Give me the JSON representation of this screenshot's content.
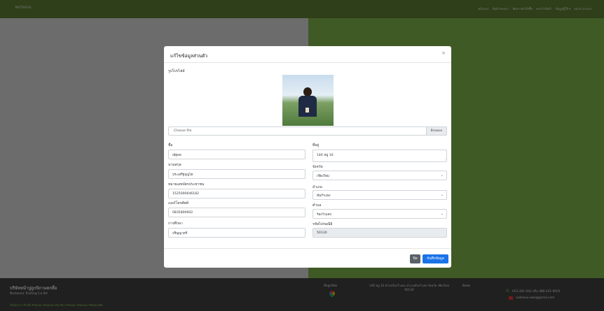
{
  "navbar": {
    "brand": "NUTSEEUI",
    "links": [
      "หน้าแรก",
      "สินค้าของเรา",
      "ติดตามคำสั่งซื้อ",
      "ตะกร้าสินค้า",
      "ข้อมูลผู้ใช้ ▾",
      "ออกจากระบบ"
    ]
  },
  "modal": {
    "title": "แก้ไขข้อมูลส่วนตัว",
    "profile_label": "รูปโปรไฟล์",
    "file_placeholder": "Choose file",
    "browse_label": "Browse",
    "fields": {
      "first_name": {
        "label": "ชื่อ",
        "value": "ณัฐพล"
      },
      "last_name": {
        "label": "นามสกุล",
        "value": "ประเสริฐบุญโต"
      },
      "id_card": {
        "label": "หมายเลขบัตรประชาชน",
        "value": "1525000646182"
      },
      "phone": {
        "label": "เบอร์โทรศัพท์",
        "value": "0835800602"
      },
      "education": {
        "label": "การศึกษา",
        "value": "ปริญญาตรี"
      },
      "address": {
        "label": "ที่อยู่",
        "value": "146 หมู่ 10"
      },
      "province": {
        "label": "จังหวัด",
        "value": "เชียงใหม่"
      },
      "district": {
        "label": "อำเภอ",
        "value": "สันกำแพง"
      },
      "subdistrict": {
        "label": "ตำบล",
        "value": "ร้องวัวแดง"
      },
      "postcode": {
        "label": "รหัสไปรษณีย์",
        "value": "50130"
      }
    },
    "close_button": "ปิด",
    "save_button": "บันทึกข้อมูล"
  },
  "footer": {
    "company": "บริษัทหน้าปูถูกนิกามดกลื่อ",
    "company_sub": "Nutseeui Trading Co.ltd",
    "tags": "#หน้าบาง #รสดี #ทดลอง #ทดลอง #หาชิม #ทดลอง #ทดลอง #ทดลองชิม",
    "map_title": "ที่อยู่บริษัท",
    "address": "146 หมู่ 10 ตำบลร้องวัวแดง อำเภอสันกำแพง จังหวัด เชียงใหม่ 50130",
    "contact_title": "ติดต่อ",
    "phone": "053-391-042 หรือ 086-431-8505",
    "email": "nutseeui.wee@gmail.com"
  }
}
